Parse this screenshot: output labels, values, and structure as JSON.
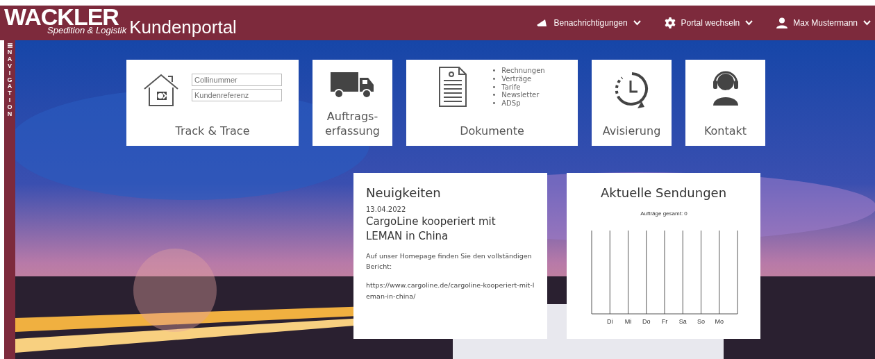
{
  "header": {
    "logo": "WACKLER",
    "logo_subtitle": "Spedition & Logistik",
    "title": "Kundenportal",
    "menus": [
      {
        "kind": "notifications",
        "label": "Benachrichtigungen"
      },
      {
        "kind": "portal",
        "label": "Portal wechseln"
      },
      {
        "kind": "user",
        "label": "Max Mustermann"
      }
    ]
  },
  "navigation": {
    "label": "NAVIGATION"
  },
  "tiles": [
    {
      "kind": "track",
      "title": "Track & Trace",
      "fields": [
        {
          "placeholder": "Collinummer"
        },
        {
          "placeholder": "Kundenreferenz"
        }
      ]
    },
    {
      "kind": "order",
      "title": "Auftrags-\nerfassung"
    },
    {
      "kind": "documents",
      "title": "Dokumente",
      "bullet": "•",
      "items": [
        "Rechnungen",
        "Verträge",
        "Tarife",
        "Newsletter",
        "ADSp"
      ]
    },
    {
      "kind": "schedule",
      "title": "Avisierung"
    },
    {
      "kind": "contact",
      "title": "Kontakt"
    }
  ],
  "news": {
    "heading": "Neuigkeiten",
    "date": "13.04.2022",
    "headline": "CargoLine kooperiert mit LEMAN in China",
    "text": "Auf unser Homepage finden Sie den vollständigen Bericht:",
    "link": "https://www.cargoline.de/cargoline-kooperiert-mit-leman-in-china/"
  },
  "shipments": {
    "heading": "Aktuelle Sendungen",
    "chart": {
      "title": "Aufträge gesamt: 0",
      "categories": [
        "Di",
        "Mi",
        "Do",
        "Fr",
        "Sa",
        "So",
        "Mo"
      ]
    }
  }
}
